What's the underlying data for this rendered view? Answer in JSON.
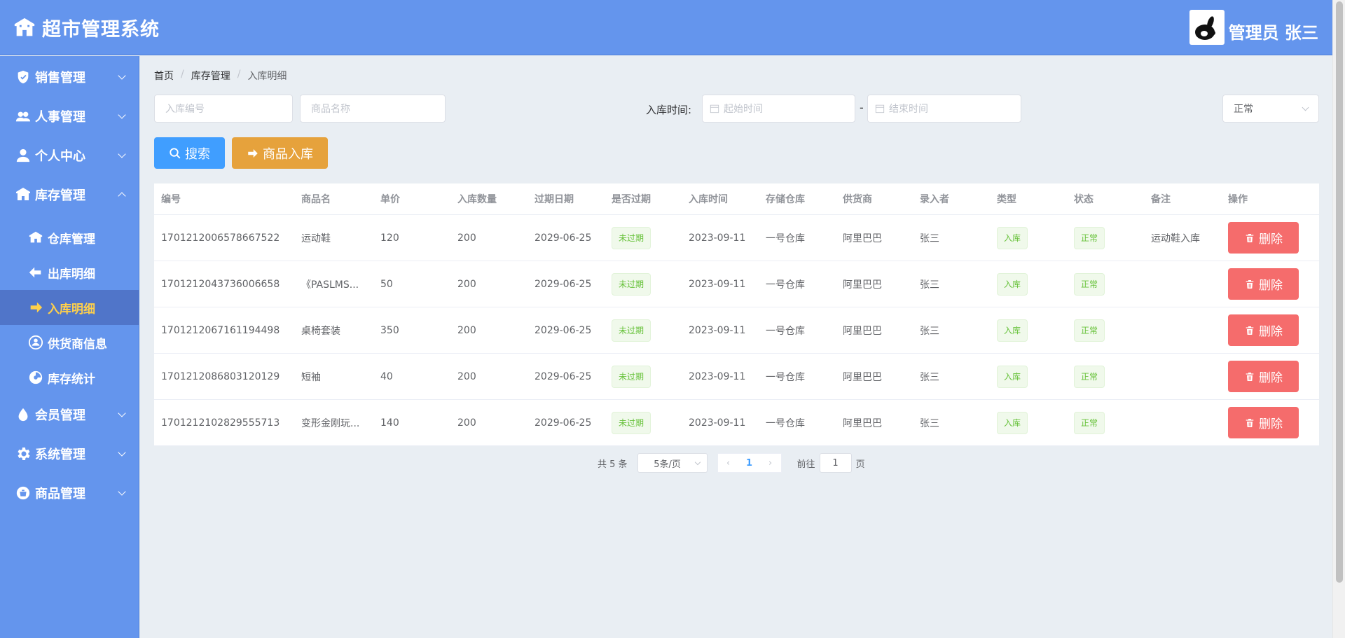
{
  "app": {
    "title": "超市管理系统",
    "user_name": "管理员 张三"
  },
  "sidebar": {
    "items": [
      {
        "label": "销售管理",
        "icon": "shield-icon"
      },
      {
        "label": "人事管理",
        "icon": "users-icon"
      },
      {
        "label": "个人中心",
        "icon": "user-icon"
      },
      {
        "label": "库存管理",
        "icon": "warehouse-icon"
      },
      {
        "label": "会员管理",
        "icon": "drop-icon"
      },
      {
        "label": "系统管理",
        "icon": "gear-icon"
      },
      {
        "label": "商品管理",
        "icon": "goods-icon"
      }
    ],
    "sub_items": [
      {
        "label": "仓库管理",
        "icon": "home-icon"
      },
      {
        "label": "出库明细",
        "icon": "outbound-icon"
      },
      {
        "label": "入库明细",
        "icon": "inbound-icon"
      },
      {
        "label": "供货商信息",
        "icon": "supplier-icon"
      },
      {
        "label": "库存统计",
        "icon": "stats-icon"
      }
    ]
  },
  "breadcrumb": [
    "首页",
    "库存管理",
    "入库明细"
  ],
  "filters": {
    "stock_no_placeholder": "入库编号",
    "product_name_placeholder": "商品名称",
    "time_label": "入库时间:",
    "start_placeholder": "起始时间",
    "end_placeholder": "结束时间",
    "dash": "-",
    "status_value": "正常"
  },
  "buttons": {
    "search": "搜索",
    "stock_in": "商品入库",
    "delete": "删除"
  },
  "table": {
    "headers": [
      "编号",
      "商品名",
      "单价",
      "入库数量",
      "过期日期",
      "是否过期",
      "入库时间",
      "存储仓库",
      "供货商",
      "录入者",
      "类型",
      "状态",
      "备注",
      "操作"
    ],
    "rows": [
      [
        "1701212006578667522",
        "运动鞋",
        "120",
        "200",
        "2029-06-25",
        "未过期",
        "2023-09-11",
        "一号仓库",
        "阿里巴巴",
        "张三",
        "入库",
        "正常",
        "运动鞋入库"
      ],
      [
        "1701212043736006658",
        "《PASLMS...",
        "50",
        "200",
        "2029-06-25",
        "未过期",
        "2023-09-11",
        "一号仓库",
        "阿里巴巴",
        "张三",
        "入库",
        "正常",
        ""
      ],
      [
        "1701212067161194498",
        "桌椅套装",
        "350",
        "200",
        "2029-06-25",
        "未过期",
        "2023-09-11",
        "一号仓库",
        "阿里巴巴",
        "张三",
        "入库",
        "正常",
        ""
      ],
      [
        "1701212086803120129",
        "短袖",
        "40",
        "200",
        "2029-06-25",
        "未过期",
        "2023-09-11",
        "一号仓库",
        "阿里巴巴",
        "张三",
        "入库",
        "正常",
        ""
      ],
      [
        "1701212102829555713",
        "变形金刚玩...",
        "140",
        "200",
        "2029-06-25",
        "未过期",
        "2023-09-11",
        "一号仓库",
        "阿里巴巴",
        "张三",
        "入库",
        "正常",
        ""
      ]
    ]
  },
  "pagination": {
    "total": "共 5 条",
    "page_size": "5条/页",
    "current": "1",
    "goto_label": "前往",
    "goto_value": "1",
    "page_suffix": "页"
  },
  "colors": {
    "primary": "#6495ed",
    "active_text": "#ffd04b",
    "search": "#409eff",
    "stock_in": "#e6a23c",
    "delete": "#f56c6c",
    "tag": "#67c23a"
  }
}
